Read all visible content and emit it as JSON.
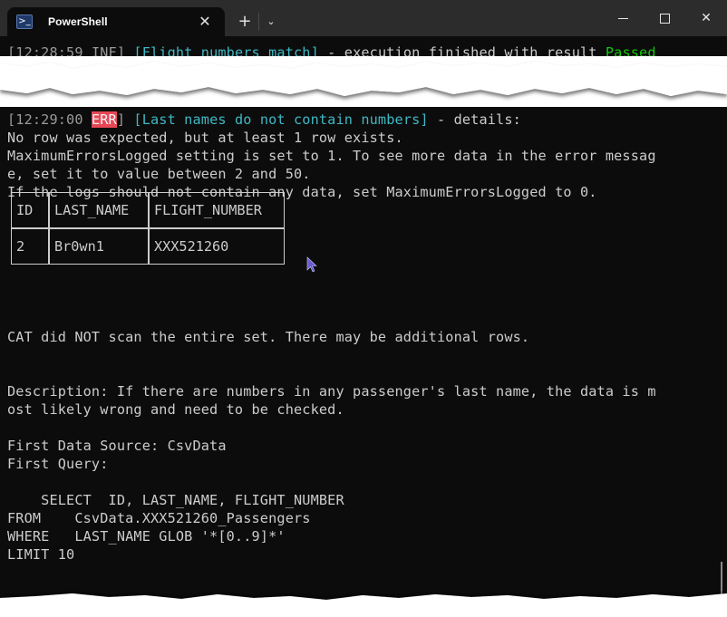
{
  "window": {
    "tab_title": "PowerShell",
    "tab_icon": "powershell-icon",
    "new_tab_icon": "plus-icon",
    "dropdown_icon": "chevron-down-icon",
    "minimize_icon": "minimize-icon",
    "maximize_icon": "maximize-icon",
    "close_icon": "close-icon"
  },
  "colors": {
    "terminal_bg": "#0c0c0c",
    "titlebar_bg": "#2c2c2c",
    "text": "#cccccc",
    "cyan": "#3fb8c4",
    "green": "#16c60c",
    "error_badge": "#e74856"
  },
  "log": {
    "line1": {
      "timestamp": "[12:28:59 ",
      "level": "INF",
      "close_bracket": "] ",
      "test_name": "[Flight numbers match]",
      "message": " - execution finished with result ",
      "result": "Passed"
    },
    "line2": {
      "timestamp": "[12:29:00 ",
      "level": "ERR",
      "close_bracket": "] ",
      "test_name": "[Last names do not contain numbers]",
      "message": " - details:"
    },
    "details": [
      "No row was expected, but at least 1 row exists.",
      "MaximumErrorsLogged setting is set to 1. To see more data in the error messag",
      "e, set it to value between 2 and 50.",
      "If the logs should not contain any data, set MaximumErrorsLogged to 0."
    ],
    "table": {
      "headers": [
        "ID",
        "LAST_NAME",
        "FLIGHT_NUMBER"
      ],
      "rows": [
        [
          "2",
          "Br0wn1",
          "XXX521260"
        ]
      ]
    },
    "scan_notice": "CAT did NOT scan the entire set. There may be additional rows.",
    "description": [
      "Description: If there are numbers in any passenger's last name, the data is m",
      "ost likely wrong and need to be checked."
    ],
    "first_data_source": "First Data Source: CsvData",
    "first_query_label": "First Query:",
    "query": [
      "    SELECT  ID, LAST_NAME, FLIGHT_NUMBER",
      "FROM    CsvData.XXX521260_Passengers",
      "WHERE   LAST_NAME GLOB '*[0..9]*'",
      "LIMIT 10"
    ]
  }
}
